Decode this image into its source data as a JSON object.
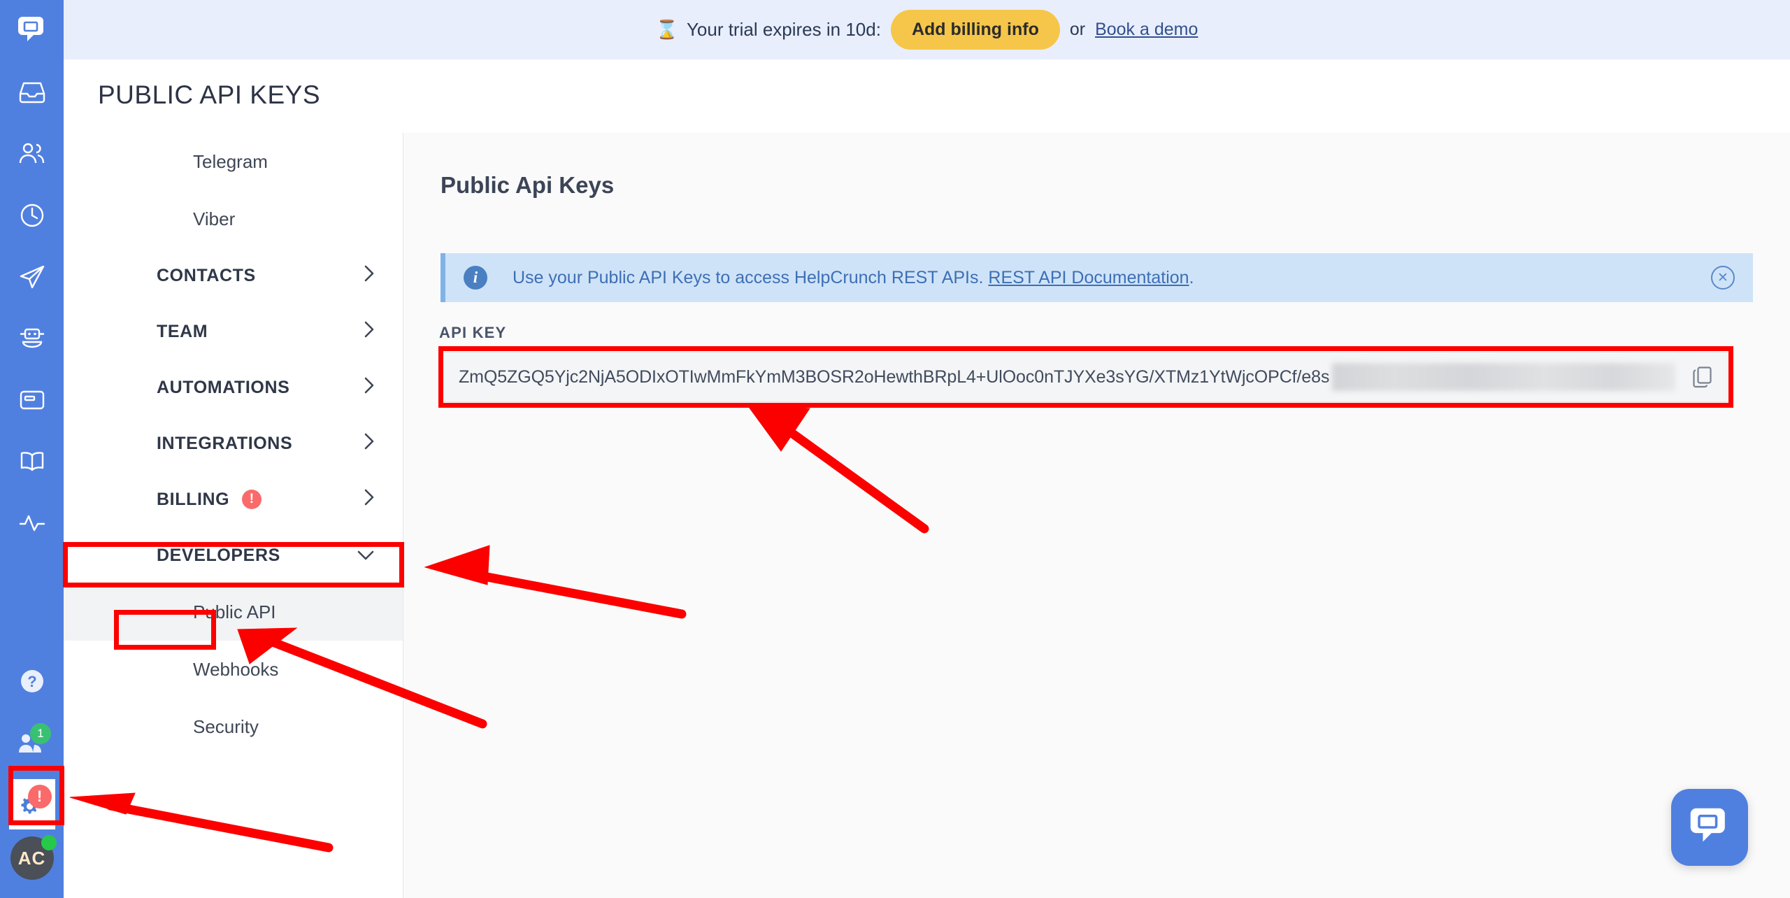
{
  "app": {
    "logo_icon": "helpcrunch-chat-logo",
    "accent_blue": "#5080df",
    "annotation_red": "#fc0000"
  },
  "trial_banner": {
    "icon": "hourglass-icon",
    "hourglass": "⌛",
    "message": "Your trial expires in 10d:",
    "days_remaining": "10d",
    "primary_button": "Add billing info",
    "separator": "or",
    "link": "Book a demo"
  },
  "header": {
    "title": "PUBLIC API KEYS"
  },
  "rail": {
    "icons": [
      {
        "name": "inbox-icon"
      },
      {
        "name": "contacts-icon"
      },
      {
        "name": "history-clock-icon"
      },
      {
        "name": "send-campaign-icon"
      },
      {
        "name": "chatbot-icon"
      },
      {
        "name": "knowledge-card-icon"
      },
      {
        "name": "knowledge-base-book-icon"
      },
      {
        "name": "activity-pulse-icon"
      }
    ],
    "help_icon": "help-question-icon",
    "team_icon": "team-invite-icon",
    "team_badge": "1",
    "settings_icon": "settings-gear-icon",
    "settings_alert": "!",
    "avatar_initials": "AC",
    "avatar_status": "online"
  },
  "sidebar": {
    "items": [
      {
        "label": "Telegram",
        "type": "sub",
        "active": false
      },
      {
        "label": "Viber",
        "type": "sub",
        "active": false
      },
      {
        "label": "CONTACTS",
        "type": "group",
        "chevron": "right",
        "badge": null
      },
      {
        "label": "TEAM",
        "type": "group",
        "chevron": "right",
        "badge": null
      },
      {
        "label": "AUTOMATIONS",
        "type": "group",
        "chevron": "right",
        "badge": null
      },
      {
        "label": "INTEGRATIONS",
        "type": "group",
        "chevron": "right",
        "badge": null
      },
      {
        "label": "BILLING",
        "type": "group",
        "chevron": "right",
        "badge": "!"
      },
      {
        "label": "DEVELOPERS",
        "type": "group",
        "chevron": "down",
        "badge": null,
        "expanded": true
      },
      {
        "label": "Public API",
        "type": "sub",
        "active": true
      },
      {
        "label": "Webhooks",
        "type": "sub",
        "active": false
      },
      {
        "label": "Security",
        "type": "sub",
        "active": false
      }
    ]
  },
  "main": {
    "title": "Public Api Keys",
    "info": {
      "icon": "info-circle-icon",
      "text_before_link": "Use your Public API Keys to access HelpCrunch REST APIs. ",
      "link_text": "REST API Documentation",
      "text_after_link": ".",
      "close_icon": "close-circle-icon"
    },
    "api_key": {
      "label": "API KEY",
      "value": "ZmQ5ZGQ5Yjc2NjA5ODIxOTIwMmFkYmM3BOSR2oHewthBRpL4+UlOoc0nTJYXe3sYG/XTMz1YtWjcOPCf/e8s",
      "masked_tail": true,
      "copy_icon": "copy-icon"
    }
  },
  "chat_launcher": {
    "icon": "chat-bubble-icon"
  },
  "annotations": {
    "highlight_boxes": [
      {
        "name": "developers-highlight"
      },
      {
        "name": "public-api-highlight"
      },
      {
        "name": "settings-gear-highlight"
      },
      {
        "name": "api-key-field-highlight"
      }
    ],
    "arrows": [
      {
        "name": "arrow-to-api-key"
      },
      {
        "name": "arrow-to-developers"
      },
      {
        "name": "arrow-to-public-api"
      },
      {
        "name": "arrow-to-settings-gear"
      }
    ]
  }
}
